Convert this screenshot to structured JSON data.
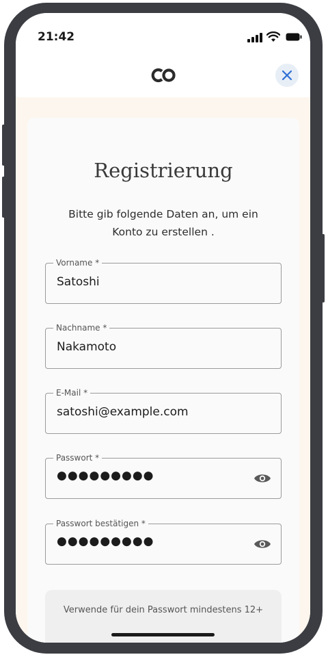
{
  "status_bar": {
    "time": "21:42"
  },
  "header": {
    "logo_text": "CO"
  },
  "form": {
    "title": "Registrierung",
    "subtitle": "Bitte gib folgende Daten an, um ein Konto zu erstellen .",
    "fields": [
      {
        "label": "Vorname *",
        "value": "Satoshi"
      },
      {
        "label": "Nachname *",
        "value": "Nakamoto"
      },
      {
        "label": "E-Mail *",
        "value": "satoshi@example.com"
      },
      {
        "label": "Passwort *",
        "value": "●●●●●●●●●"
      },
      {
        "label": "Passwort bestätigen *",
        "value": "●●●●●●●●●"
      }
    ],
    "hint": "Verwende für dein Passwort mindestens 12+"
  },
  "icons": {
    "close": "close-icon",
    "eye": "eye-icon",
    "signal": "signal-icon",
    "wifi": "wifi-icon",
    "battery": "battery-icon"
  },
  "colors": {
    "accent": "#2f6fd6",
    "close_bg": "#e7eef6",
    "cream_bg": "#fdf6ee"
  }
}
